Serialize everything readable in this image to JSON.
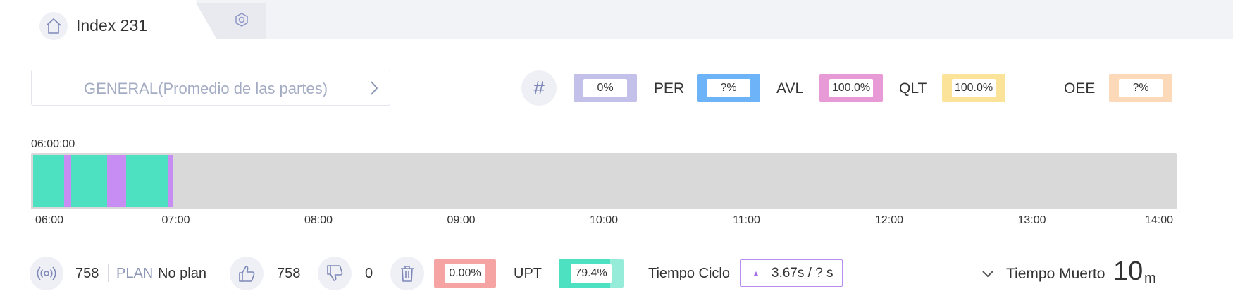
{
  "tab": {
    "title": "Index 231",
    "home_icon": "home-icon",
    "settings_icon": "hexagon-settings-icon"
  },
  "selector": {
    "label": "GENERAL(Promedio de las partes)",
    "chevron_icon": "chevron-right-icon"
  },
  "kpis": {
    "count": {
      "value": "0%",
      "color": "#c3c0ea"
    },
    "per": {
      "label": "PER",
      "value": "?%",
      "color": "#6db3f8"
    },
    "avl": {
      "label": "AVL",
      "value": "100.0%",
      "color": "#e79ad6"
    },
    "qlt": {
      "label": "QLT",
      "value": "100.0%",
      "color": "#fbe49a"
    },
    "oee": {
      "label": "OEE",
      "value": "?%",
      "color": "#fcd9b9"
    }
  },
  "timeline": {
    "start_label": "06:00:00",
    "range_hours": [
      6,
      14
    ],
    "colors": {
      "running": "#4de0c1",
      "stopped": "#c78df2",
      "empty": "#d9d9d9"
    },
    "segments": [
      {
        "state": "running",
        "from": "06:00",
        "to": "06:13"
      },
      {
        "state": "stopped",
        "from": "06:13",
        "to": "06:16"
      },
      {
        "state": "running",
        "from": "06:16",
        "to": "06:31"
      },
      {
        "state": "stopped",
        "from": "06:31",
        "to": "06:39"
      },
      {
        "state": "running",
        "from": "06:39",
        "to": "06:57"
      },
      {
        "state": "stopped",
        "from": "06:57",
        "to": "06:59"
      }
    ],
    "ticks": [
      "06:00",
      "07:00",
      "08:00",
      "09:00",
      "10:00",
      "11:00",
      "12:00",
      "13:00",
      "14:00"
    ]
  },
  "stats": {
    "produced": "758",
    "plan_label": "PLAN",
    "plan_value": "No plan",
    "good": "758",
    "bad": "0",
    "scrap_rate": "0.00%",
    "scrap_color": "#f5a3a3",
    "upt_label": "UPT",
    "upt_value": "79.4%",
    "upt_fraction": 0.794,
    "upt_color": "#4de0c1",
    "upt_track_color": "#95ecd9",
    "cycle_label": "Tiempo Ciclo",
    "cycle_value": "3.67s / ? s",
    "dead_label": "Tiempo Muerto",
    "dead_value": "10",
    "dead_unit": "m"
  }
}
